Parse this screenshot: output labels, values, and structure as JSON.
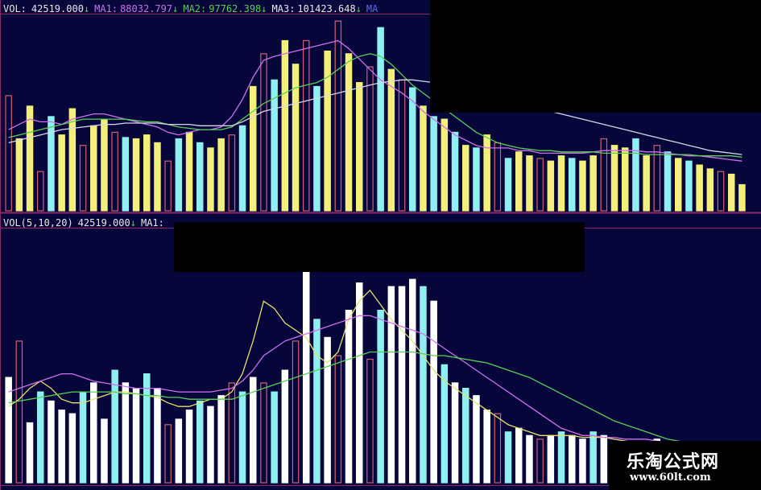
{
  "colors": {
    "background": "#06063a",
    "grid": "#8a2a6a",
    "text_label": "#e8e8e8",
    "ma1": "#d070f0",
    "ma2": "#58d058",
    "ma3": "#d8d8e8",
    "ma4": "#5b6cf0",
    "arrow": "#40e040",
    "bar_yellow": "#f4ef7a",
    "bar_cyan": "#8ef0f0",
    "bar_white": "#ffffff",
    "bar_hollow": "#d06070",
    "bar_blue": "#aee8f4",
    "ma_yellow": "#e8e070"
  },
  "top_panel": {
    "vol_label": "VOL:",
    "vol_value": "42519.000",
    "ma1_label": "MA1:",
    "ma1_value": "88032.797",
    "ma2_label": "MA2:",
    "ma2_value": "97762.398",
    "ma3_label": "MA3:",
    "ma3_value": "101423.648",
    "ma4_label": "MA",
    "arrow": "↓"
  },
  "bottom_panel": {
    "vol_label": "VOL(5,10,20)",
    "vol_value": "42519.000",
    "ma1_label": "MA1:",
    "arrow": "↓"
  },
  "watermark": {
    "line1": "乐淘公式网",
    "line2": "www.60lt.com"
  },
  "chart_data": [
    {
      "type": "bar",
      "panel": "top",
      "series": [
        {
          "name": "VOL",
          "values": [
            88,
            55,
            80,
            30,
            72,
            58,
            78,
            50,
            65,
            70,
            60,
            56,
            55,
            58,
            52,
            38,
            55,
            60,
            52,
            48,
            55,
            58,
            65,
            95,
            120,
            100,
            130,
            112,
            130,
            95,
            122,
            145,
            120,
            98,
            110,
            140,
            108,
            100,
            94,
            80,
            72,
            70,
            60,
            50,
            48,
            58,
            52,
            40,
            45,
            42,
            40,
            38,
            42,
            40,
            38,
            42,
            55,
            50,
            48,
            55,
            42,
            50,
            45,
            40,
            38,
            35,
            32,
            30,
            28,
            20
          ],
          "styles": [
            "h",
            "y",
            "y",
            "h",
            "c",
            "y",
            "y",
            "h",
            "y",
            "y",
            "h",
            "c",
            "y",
            "y",
            "y",
            "h",
            "c",
            "y",
            "c",
            "y",
            "y",
            "h",
            "c",
            "y",
            "h",
            "c",
            "y",
            "y",
            "h",
            "c",
            "y",
            "h",
            "y",
            "y",
            "h",
            "c",
            "y",
            "h",
            "c",
            "y",
            "c",
            "y",
            "c",
            "y",
            "c",
            "y",
            "h",
            "c",
            "y",
            "y",
            "h",
            "y",
            "y",
            "c",
            "y",
            "y",
            "h",
            "y",
            "y",
            "c",
            "y",
            "h",
            "c",
            "y",
            "c",
            "y",
            "y",
            "h",
            "y",
            "y"
          ],
          "max": 150
        },
        {
          "name": "MA1",
          "values": [
            62,
            66,
            70,
            68,
            68,
            66,
            70,
            72,
            74,
            74,
            72,
            70,
            68,
            66,
            64,
            60,
            58,
            60,
            62,
            62,
            64,
            72,
            85,
            102,
            115,
            118,
            120,
            122,
            124,
            126,
            128,
            130,
            124,
            116,
            108,
            100,
            95,
            90,
            84,
            76,
            70,
            64,
            58,
            54,
            50,
            48,
            48,
            48,
            46,
            46,
            44,
            44,
            44,
            44,
            44,
            45,
            46,
            46,
            46,
            46,
            45,
            45,
            44,
            43,
            42,
            42,
            41,
            40,
            39,
            38
          ]
        },
        {
          "name": "MA2",
          "values": [
            56,
            58,
            60,
            62,
            64,
            66,
            68,
            70,
            70,
            70,
            70,
            70,
            69,
            68,
            68,
            66,
            64,
            63,
            62,
            62,
            62,
            64,
            70,
            76,
            82,
            86,
            90,
            94,
            96,
            98,
            102,
            108,
            114,
            118,
            120,
            118,
            112,
            104,
            96,
            90,
            84,
            78,
            72,
            66,
            60,
            56,
            52,
            50,
            48,
            47,
            46,
            46,
            45,
            45,
            45,
            45,
            44,
            44,
            44,
            44,
            43,
            43,
            43,
            43,
            43,
            42,
            42,
            42,
            42,
            41
          ]
        },
        {
          "name": "MA3",
          "values": [
            52,
            54,
            56,
            58,
            60,
            62,
            63,
            64,
            65,
            66,
            66,
            67,
            67,
            67,
            67,
            66,
            66,
            66,
            65,
            65,
            65,
            65,
            68,
            72,
            76,
            78,
            80,
            82,
            84,
            86,
            88,
            90,
            92,
            94,
            96,
            98,
            99,
            100,
            100,
            99,
            98,
            96,
            94,
            92,
            90,
            88,
            86,
            84,
            82,
            80,
            78,
            76,
            74,
            72,
            70,
            68,
            66,
            64,
            62,
            60,
            58,
            56,
            54,
            52,
            50,
            48,
            46,
            45,
            44,
            43
          ]
        }
      ]
    },
    {
      "type": "bar",
      "panel": "bottom",
      "series": [
        {
          "name": "VOL(5,10,20)",
          "values": [
            58,
            78,
            33,
            50,
            45,
            40,
            38,
            50,
            55,
            35,
            62,
            55,
            52,
            60,
            52,
            32,
            35,
            40,
            45,
            42,
            48,
            55,
            50,
            58,
            55,
            50,
            62,
            78,
            138,
            90,
            80,
            70,
            95,
            110,
            68,
            95,
            108,
            108,
            112,
            108,
            100,
            65,
            55,
            52,
            48,
            40,
            38,
            28,
            30,
            26,
            24,
            26,
            28,
            26,
            24,
            28,
            26,
            22,
            20,
            20,
            22,
            24,
            20,
            18,
            16,
            15,
            14,
            12,
            12,
            10
          ],
          "styles": [
            "w",
            "h",
            "w",
            "c",
            "w",
            "w",
            "w",
            "c",
            "w",
            "w",
            "c",
            "w",
            "w",
            "c",
            "w",
            "h",
            "w",
            "w",
            "c",
            "w",
            "w",
            "h",
            "c",
            "w",
            "h",
            "c",
            "w",
            "h",
            "w",
            "c",
            "w",
            "h",
            "w",
            "w",
            "h",
            "c",
            "w",
            "w",
            "w",
            "c",
            "w",
            "c",
            "w",
            "c",
            "w",
            "w",
            "h",
            "c",
            "w",
            "w",
            "h",
            "w",
            "c",
            "w",
            "w",
            "c",
            "w",
            "c",
            "w",
            "w",
            "h",
            "w",
            "c",
            "w",
            "w",
            "h",
            "w",
            "w",
            "c",
            "w"
          ],
          "max": 140
        },
        {
          "name": "MA1",
          "values": [
            42,
            46,
            52,
            56,
            52,
            46,
            44,
            44,
            46,
            48,
            50,
            50,
            49,
            48,
            47,
            44,
            42,
            42,
            44,
            46,
            46,
            50,
            60,
            78,
            100,
            96,
            88,
            84,
            80,
            70,
            66,
            72,
            90,
            100,
            106,
            98,
            90,
            84,
            78,
            70,
            62,
            56,
            52,
            48,
            44,
            40,
            36,
            32,
            30,
            28,
            26,
            26,
            26,
            26,
            25,
            25,
            25,
            24,
            23,
            22,
            22,
            21,
            20,
            20,
            19,
            19,
            18,
            17,
            16,
            15
          ]
        },
        {
          "name": "MA2",
          "values": [
            50,
            52,
            54,
            56,
            58,
            60,
            60,
            58,
            56,
            55,
            54,
            53,
            52,
            52,
            52,
            51,
            50,
            50,
            50,
            50,
            51,
            52,
            56,
            62,
            70,
            74,
            78,
            80,
            82,
            84,
            86,
            88,
            90,
            92,
            92,
            90,
            88,
            86,
            84,
            82,
            78,
            74,
            70,
            66,
            62,
            58,
            54,
            50,
            46,
            42,
            38,
            34,
            30,
            28,
            26,
            26,
            25,
            25,
            24,
            24,
            24,
            23,
            22,
            22,
            21,
            21,
            20,
            20,
            19,
            18
          ]
        },
        {
          "name": "MA3",
          "values": [
            44,
            45,
            46,
            47,
            48,
            49,
            50,
            50,
            50,
            50,
            50,
            49,
            49,
            48,
            48,
            47,
            47,
            46,
            46,
            46,
            46,
            46,
            48,
            50,
            52,
            54,
            56,
            58,
            60,
            62,
            64,
            66,
            68,
            70,
            72,
            72,
            72,
            72,
            72,
            71,
            70,
            70,
            69,
            68,
            67,
            66,
            64,
            62,
            60,
            58,
            55,
            52,
            49,
            46,
            43,
            40,
            37,
            34,
            32,
            30,
            28,
            26,
            24,
            23,
            22,
            21,
            20,
            19,
            18,
            17
          ]
        }
      ]
    }
  ]
}
